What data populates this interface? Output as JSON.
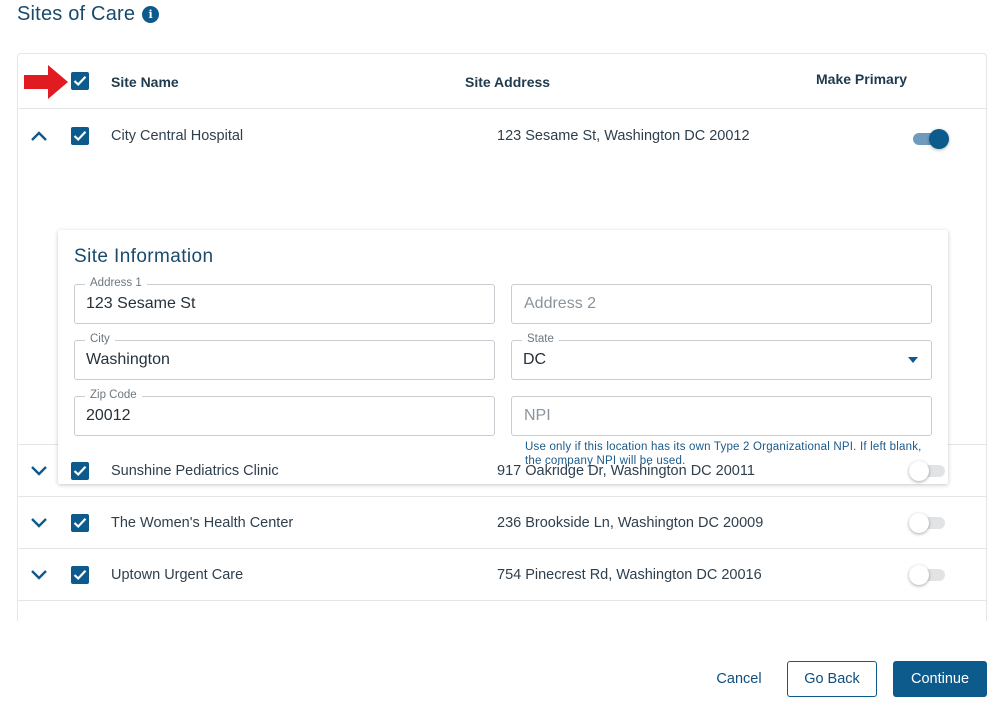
{
  "page": {
    "title": "Sites of Care",
    "info_icon": "info-icon"
  },
  "table": {
    "columns": {
      "site_name": "Site Name",
      "site_address": "Site Address",
      "make_primary": "Make Primary"
    },
    "rows": [
      {
        "name": "City Central Hospital",
        "address": "123 Sesame St, Washington DC 20012",
        "checked": true,
        "expanded": true,
        "primary": true
      },
      {
        "name": "Sunshine Pediatrics Clinic",
        "address": "917 Oakridge Dr, Washington DC 20011",
        "checked": true,
        "expanded": false,
        "primary": false
      },
      {
        "name": "The Women's Health Center",
        "address": "236 Brookside Ln, Washington DC 20009",
        "checked": true,
        "expanded": false,
        "primary": false
      },
      {
        "name": "Uptown Urgent Care",
        "address": "754 Pinecrest Rd, Washington DC 20016",
        "checked": true,
        "expanded": false,
        "primary": false
      }
    ]
  },
  "site_info": {
    "title": "Site Information",
    "address1": {
      "label": "Address 1",
      "value": "123 Sesame St"
    },
    "address2": {
      "placeholder": "Address 2"
    },
    "city": {
      "label": "City",
      "value": "Washington"
    },
    "state": {
      "label": "State",
      "value": "DC"
    },
    "zip": {
      "label": "Zip Code",
      "value": "20012"
    },
    "npi": {
      "placeholder": "NPI",
      "helper": "Use only if this location has its own Type 2 Organizational NPI. If left blank, the company NPI will be used."
    }
  },
  "footer": {
    "cancel": "Cancel",
    "go_back": "Go Back",
    "continue": "Continue"
  },
  "colors": {
    "primary": "#0d5a8c",
    "arrow": "#e01b22",
    "toggle_on_track": "#6f9bbd"
  }
}
